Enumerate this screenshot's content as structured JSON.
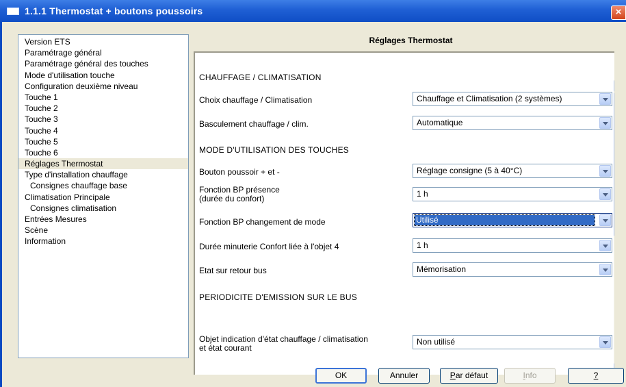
{
  "window": {
    "title": "1.1.1 Thermostat + boutons poussoirs",
    "close_glyph": "×"
  },
  "tree": {
    "items": [
      {
        "label": "Version ETS"
      },
      {
        "label": "Paramétrage général"
      },
      {
        "label": "Paramétrage général des touches"
      },
      {
        "label": "Mode d'utilisation touche"
      },
      {
        "label": "Configuration deuxième niveau"
      },
      {
        "label": "Touche 1"
      },
      {
        "label": "Touche 2"
      },
      {
        "label": "Touche 3"
      },
      {
        "label": "Touche 4"
      },
      {
        "label": "Touche 5"
      },
      {
        "label": "Touche 6"
      },
      {
        "label": "Réglages Thermostat",
        "selected": true
      },
      {
        "label": "Type d'installation chauffage"
      },
      {
        "label": "Consignes chauffage base",
        "indent": true
      },
      {
        "label": "Climatisation Principale"
      },
      {
        "label": "Consignes climatisation",
        "indent": true
      },
      {
        "label": "Entrées Mesures"
      },
      {
        "label": "Scène"
      },
      {
        "label": "Information"
      }
    ]
  },
  "panel": {
    "title": "Réglages Thermostat",
    "sections": {
      "heating": "CHAUFFAGE / CLIMATISATION",
      "touch_mode": "MODE D'UTILISATION DES TOUCHES",
      "bus": "PERIODICITE D'EMISSION SUR LE BUS"
    },
    "params": [
      {
        "label": "Choix chauffage / Climatisation",
        "value": "Chauffage et Climatisation (2 systèmes)"
      },
      {
        "label": "Basculement chauffage / clim.",
        "value": "Automatique"
      },
      {
        "label": "Bouton poussoir + et -",
        "value": "Réglage consigne (5 à 40°C)"
      },
      {
        "label": "Fonction BP présence",
        "label2": "(durée du confort)",
        "value": "1 h"
      },
      {
        "label": "Fonction BP changement de mode",
        "value": "Utilisé"
      },
      {
        "label": "Durée minuterie Confort liée à l'objet 4",
        "value": "1 h"
      },
      {
        "label": "Etat sur retour bus",
        "value": "Mémorisation"
      },
      {
        "label": "Objet indication d'état chauffage / climatisation",
        "label2": "et état courant",
        "value": "Non utilisé"
      }
    ]
  },
  "buttons": {
    "ok": "OK",
    "cancel": "Annuler",
    "default_p": "P",
    "default_rest": "ar défaut",
    "info_i": "I",
    "info_rest": "nfo",
    "help": "?"
  },
  "colors": {
    "titlebar": "#0f4ec5",
    "window_bg": "#ece9d8",
    "selection": "#316ac5"
  }
}
